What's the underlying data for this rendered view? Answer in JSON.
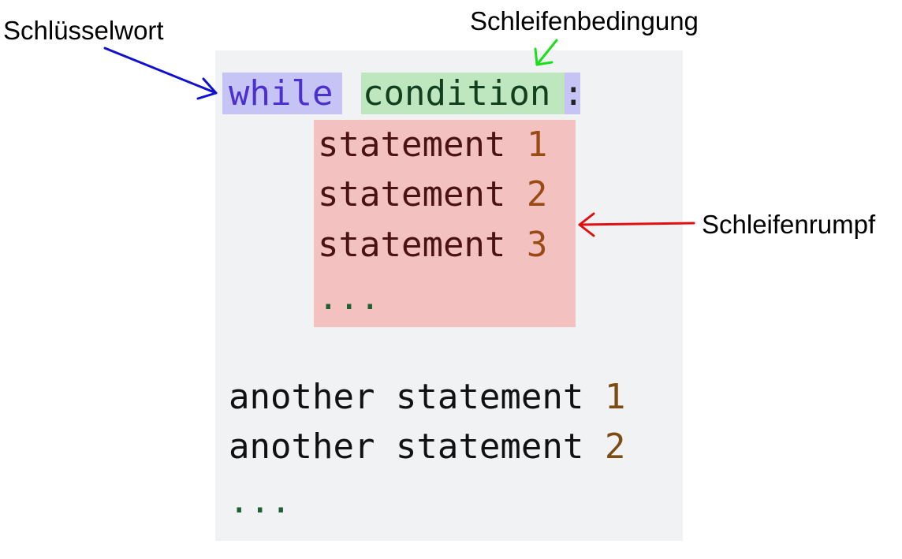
{
  "code": {
    "keyword": "while",
    "condition": "condition",
    "colon": ":",
    "body": [
      {
        "text": "statement",
        "num": "1"
      },
      {
        "text": "statement",
        "num": "2"
      },
      {
        "text": "statement",
        "num": "3"
      }
    ],
    "body_ellipsis": "...",
    "after": [
      {
        "text": "another statement",
        "num": "1"
      },
      {
        "text": "another statement",
        "num": "2"
      }
    ],
    "after_ellipsis": "..."
  },
  "labels": {
    "keyword": "Schlüsselwort",
    "condition": "Schleifenbedingung",
    "body": "Schleifenrumpf"
  },
  "colors": {
    "keyword_arrow": "#1010d0",
    "condition_arrow": "#19e019",
    "body_arrow": "#e01010"
  }
}
